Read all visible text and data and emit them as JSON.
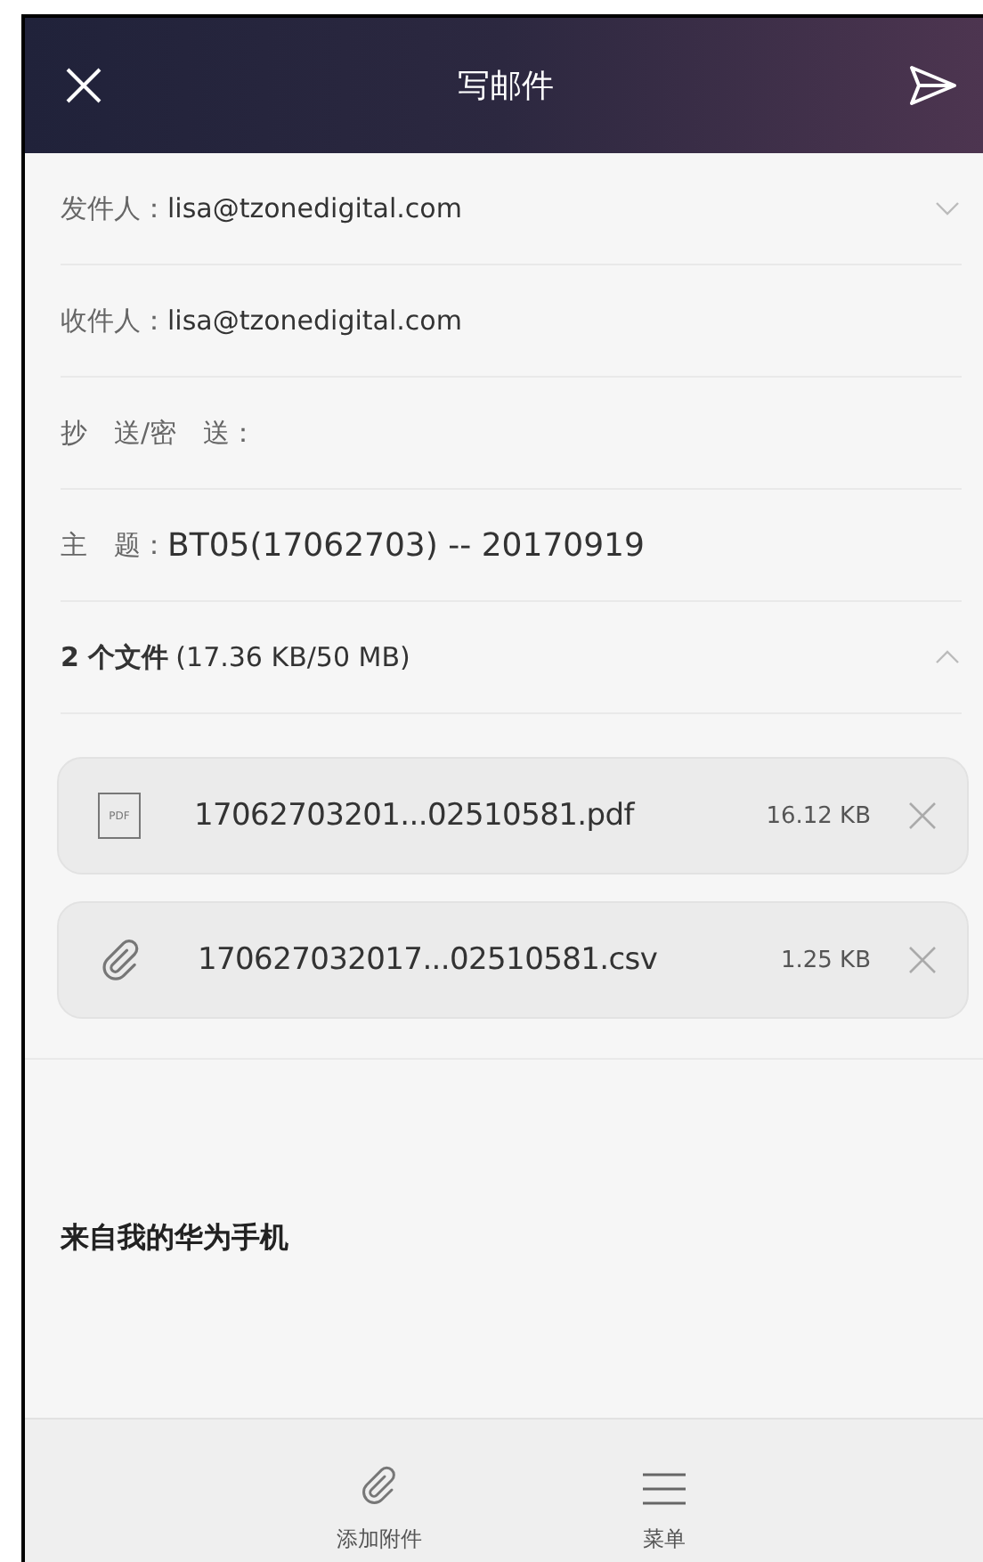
{
  "header": {
    "title": "写邮件"
  },
  "fields": [
    {
      "label": "发件人：",
      "value": "lisa@tzonedigital.com",
      "kind": "dropdown"
    },
    {
      "label": "收件人：",
      "value": "lisa@tzonedigital.com",
      "kind": "plain"
    },
    {
      "label": "抄　送/密　送：",
      "kind": "plain"
    },
    {
      "label": "主　题：",
      "value": "BT05(17062703) -- 20170919",
      "kind": "subject"
    }
  ],
  "attachments": {
    "count": "2 个文件",
    "size": "(17.36 KB/50 MB)",
    "expanded": true,
    "files": [
      {
        "kind": "pdf",
        "icon_text": "PDF",
        "name": "17062703201...02510581.pdf",
        "size": "16.12 KB"
      },
      {
        "kind": "link",
        "name": "170627032017...02510581.csv",
        "size": "1.25 KB"
      }
    ]
  },
  "body": {
    "signature": "来自我的华为手机"
  },
  "bottom_bar": [
    {
      "kind": "attach",
      "label": "添加附件"
    },
    {
      "kind": "menu",
      "label": "菜单"
    }
  ]
}
